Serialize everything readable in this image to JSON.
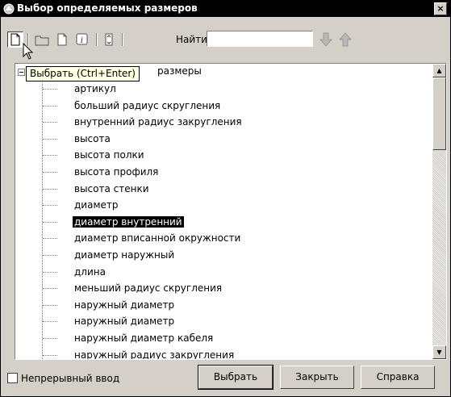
{
  "window": {
    "title": "Выбор определяемых размеров",
    "close_glyph": "×"
  },
  "toolbar": {
    "find_label": "Найти",
    "find_value": "",
    "buttons": [
      "select-icon",
      "folder-icon",
      "page-icon",
      "info-icon",
      "list-icon",
      "arrow-down-icon",
      "arrow-up-icon"
    ],
    "tooltip": "Выбрать (Ctrl+Enter)"
  },
  "tree": {
    "root_label_visible": "размеры",
    "items": [
      "артикул",
      "больший радиус скругления",
      "внутренний радиус закругления",
      "высота",
      "высота полки",
      "высота профиля",
      "высота стенки",
      "диаметр",
      "диаметр внутренний",
      "диаметр вписанной окружности",
      "диаметр наружный",
      "длина",
      "меньший радиус скругления",
      "наружный диаметр",
      "наружный диаметр",
      "наружный диаметр кабеля",
      "наружный радиус закругления"
    ],
    "selected_index": 8
  },
  "footer": {
    "continuous_label": "Непрерывный ввод",
    "continuous_checked": false,
    "select_button": "Выбрать",
    "close_button": "Закрыть",
    "help_button": "Справка"
  }
}
